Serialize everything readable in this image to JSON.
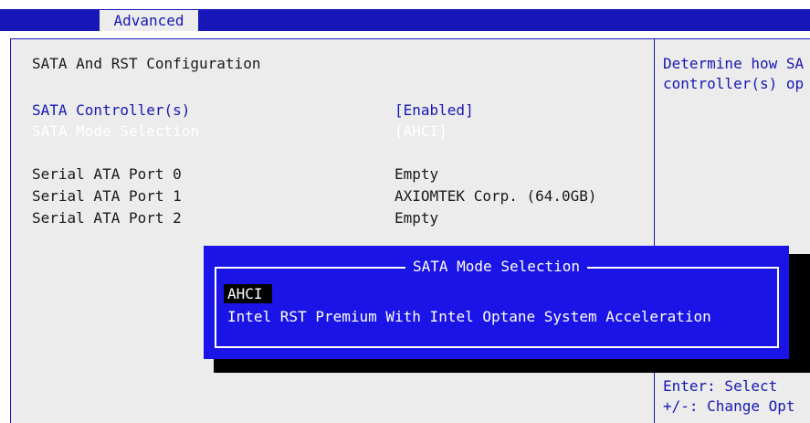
{
  "header": {
    "tab_label": "Advanced"
  },
  "main": {
    "section_title": "SATA And RST Configuration",
    "settings": [
      {
        "label": "SATA Controller(s)",
        "value": "[Enabled]"
      },
      {
        "label": "SATA Mode Selection",
        "value": "[AHCI]"
      }
    ],
    "ports": [
      {
        "label": "Serial ATA Port 0",
        "value": "Empty"
      },
      {
        "label": "Serial ATA Port 1",
        "value": "AXIOMTEK Corp. (64.0GB)"
      },
      {
        "label": "Serial ATA Port 2",
        "value": "Empty"
      }
    ]
  },
  "help": {
    "line1": "Determine how SA",
    "line2": "controller(s) op",
    "keys": [
      "Enter: Select",
      "+/-: Change Opt"
    ]
  },
  "popup": {
    "title": "SATA Mode Selection",
    "options": [
      "AHCI",
      "Intel RST Premium With Intel Optane System Acceleration"
    ],
    "selected_index": 0
  },
  "colors": {
    "accent_blue": "#1717b8",
    "popup_blue": "#1a14e6",
    "panel_gray": "#ececec"
  }
}
